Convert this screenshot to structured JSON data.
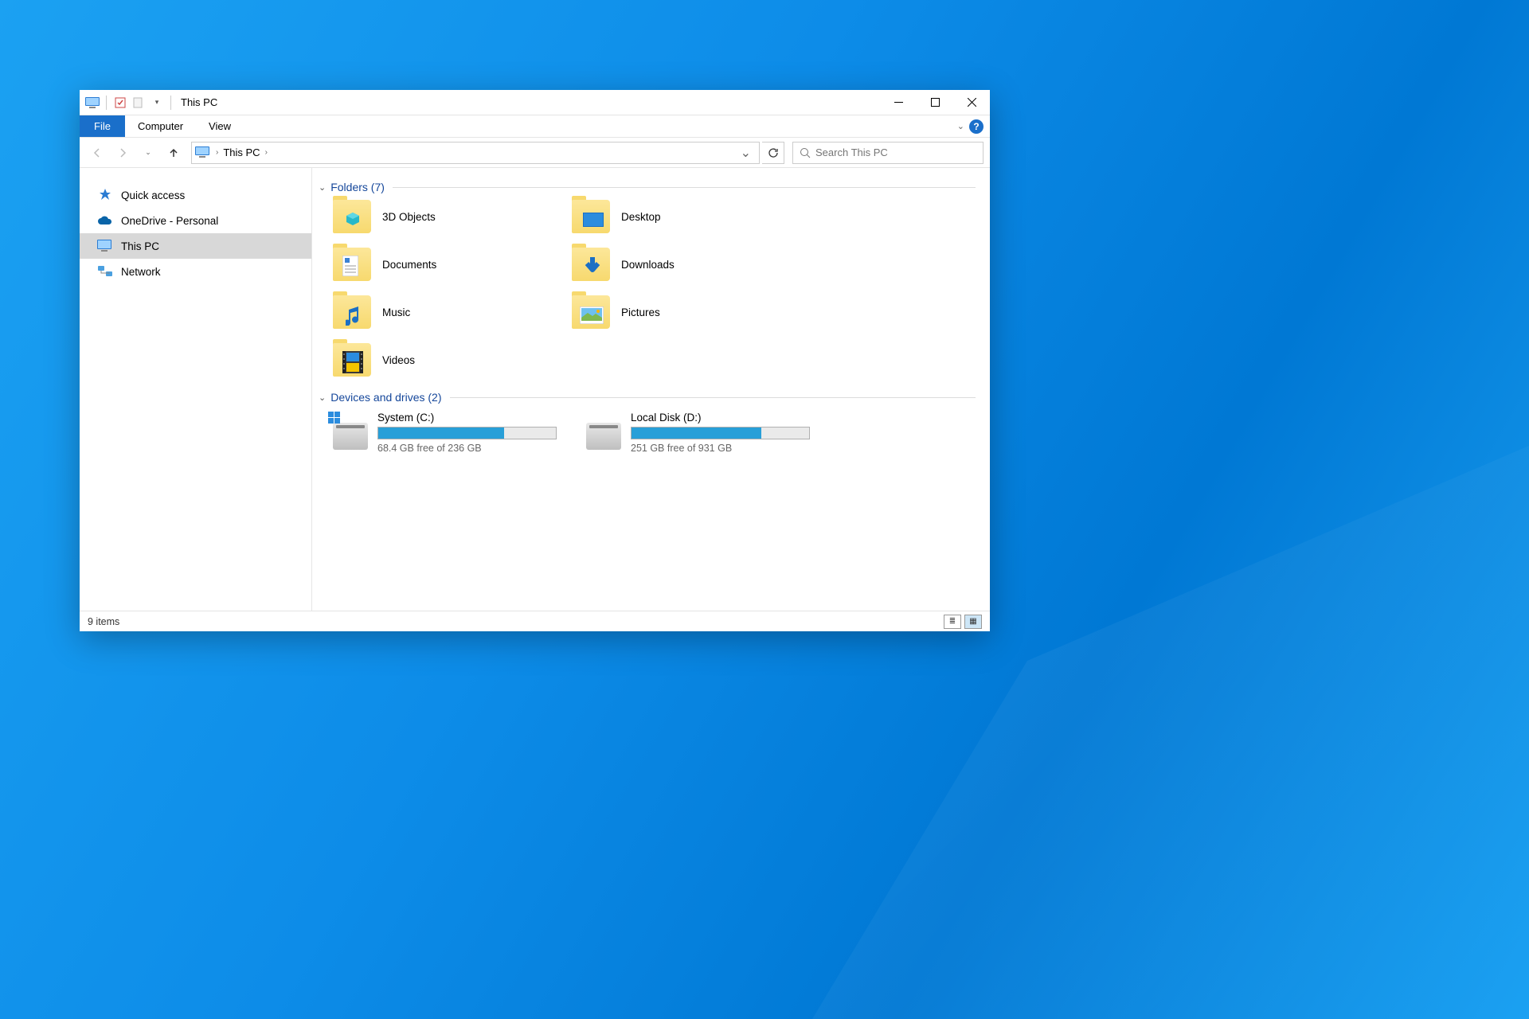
{
  "title": "This PC",
  "menubar": {
    "file": "File",
    "computer": "Computer",
    "view": "View"
  },
  "breadcrumb": "This PC",
  "search": {
    "placeholder": "Search This PC"
  },
  "sidebar": {
    "items": [
      {
        "label": "Quick access"
      },
      {
        "label": "OneDrive - Personal"
      },
      {
        "label": "This PC"
      },
      {
        "label": "Network"
      }
    ]
  },
  "groups": {
    "folders": {
      "header": "Folders (7)"
    },
    "drives": {
      "header": "Devices and drives (2)"
    }
  },
  "folders": [
    {
      "label": "3D Objects"
    },
    {
      "label": "Desktop"
    },
    {
      "label": "Documents"
    },
    {
      "label": "Downloads"
    },
    {
      "label": "Music"
    },
    {
      "label": "Pictures"
    },
    {
      "label": "Videos"
    }
  ],
  "drives": [
    {
      "name": "System (C:)",
      "free_text": "68.4 GB free of 236 GB",
      "used_pct": 71
    },
    {
      "name": "Local Disk (D:)",
      "free_text": "251 GB free of 931 GB",
      "used_pct": 73
    }
  ],
  "status": {
    "items": "9 items"
  }
}
